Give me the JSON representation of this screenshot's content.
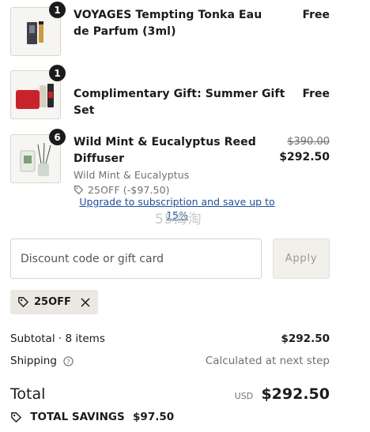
{
  "line_items": [
    {
      "qty": "1",
      "title": "VOYAGES Tempting Tonka Eau de Parfum (3ml)",
      "price": "Free"
    },
    {
      "qty": "1",
      "title": "Complimentary Gift: Summer Gift Set",
      "price": "Free"
    },
    {
      "qty": "6",
      "title": "Wild Mint & Eucalyptus Reed Diffuser",
      "variant": "Wild Mint & Eucalyptus",
      "discount_tag": "25OFF (-$97.50)",
      "original_price": "$390.00",
      "price": "$292.50",
      "upgrade_link": "Upgrade to subscription and save up to 15%"
    }
  ],
  "watermark": "55海淘",
  "discount": {
    "placeholder": "Discount code or gift card",
    "apply_label": "Apply",
    "applied_code": "25OFF"
  },
  "summary": {
    "subtotal_label": "Subtotal · 8 items",
    "subtotal_value": "$292.50",
    "shipping_label": "Shipping",
    "shipping_value": "Calculated at next step",
    "total_label": "Total",
    "currency": "USD",
    "total_value": "$292.50",
    "savings_label": "TOTAL SAVINGS",
    "savings_value": "$97.50"
  },
  "colors": {
    "text": "#1b1b1b",
    "link": "#1d4f9c",
    "chip_bg": "#ebe8e1"
  }
}
